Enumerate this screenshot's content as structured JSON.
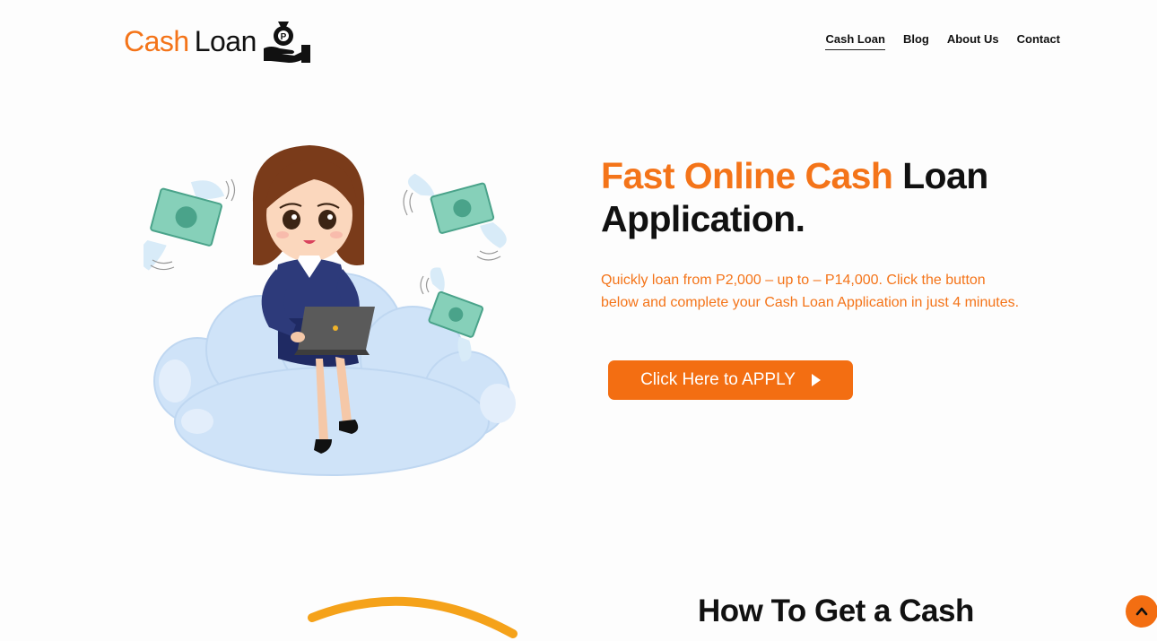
{
  "brand": {
    "name_part1": "Cash",
    "name_part2": "Loan",
    "icon": "money-hand-icon",
    "accent_color": "#f47419"
  },
  "nav": {
    "items": [
      {
        "label": "Cash Loan",
        "active": true
      },
      {
        "label": "Blog",
        "active": false
      },
      {
        "label": "About Us",
        "active": false
      },
      {
        "label": "Contact",
        "active": false
      }
    ]
  },
  "hero": {
    "title_accent": "Fast Online Cash",
    "title_rest_1": " Loan",
    "title_rest_2": "Application.",
    "subtitle": "Quickly loan from P2,000 – up to – P14,000. Click the button below and complete your Cash Loan Application in just 4 minutes.",
    "cta_label": "Click Here to APPLY",
    "cta_icon": "play-icon",
    "illustration": "woman-on-cloud-with-laptop-illustration"
  },
  "section2": {
    "title": "How To Get a Cash"
  },
  "scroll_top_icon": "chevron-up-icon",
  "colors": {
    "accent": "#f47419",
    "button": "#f36e12",
    "text": "#111111"
  }
}
